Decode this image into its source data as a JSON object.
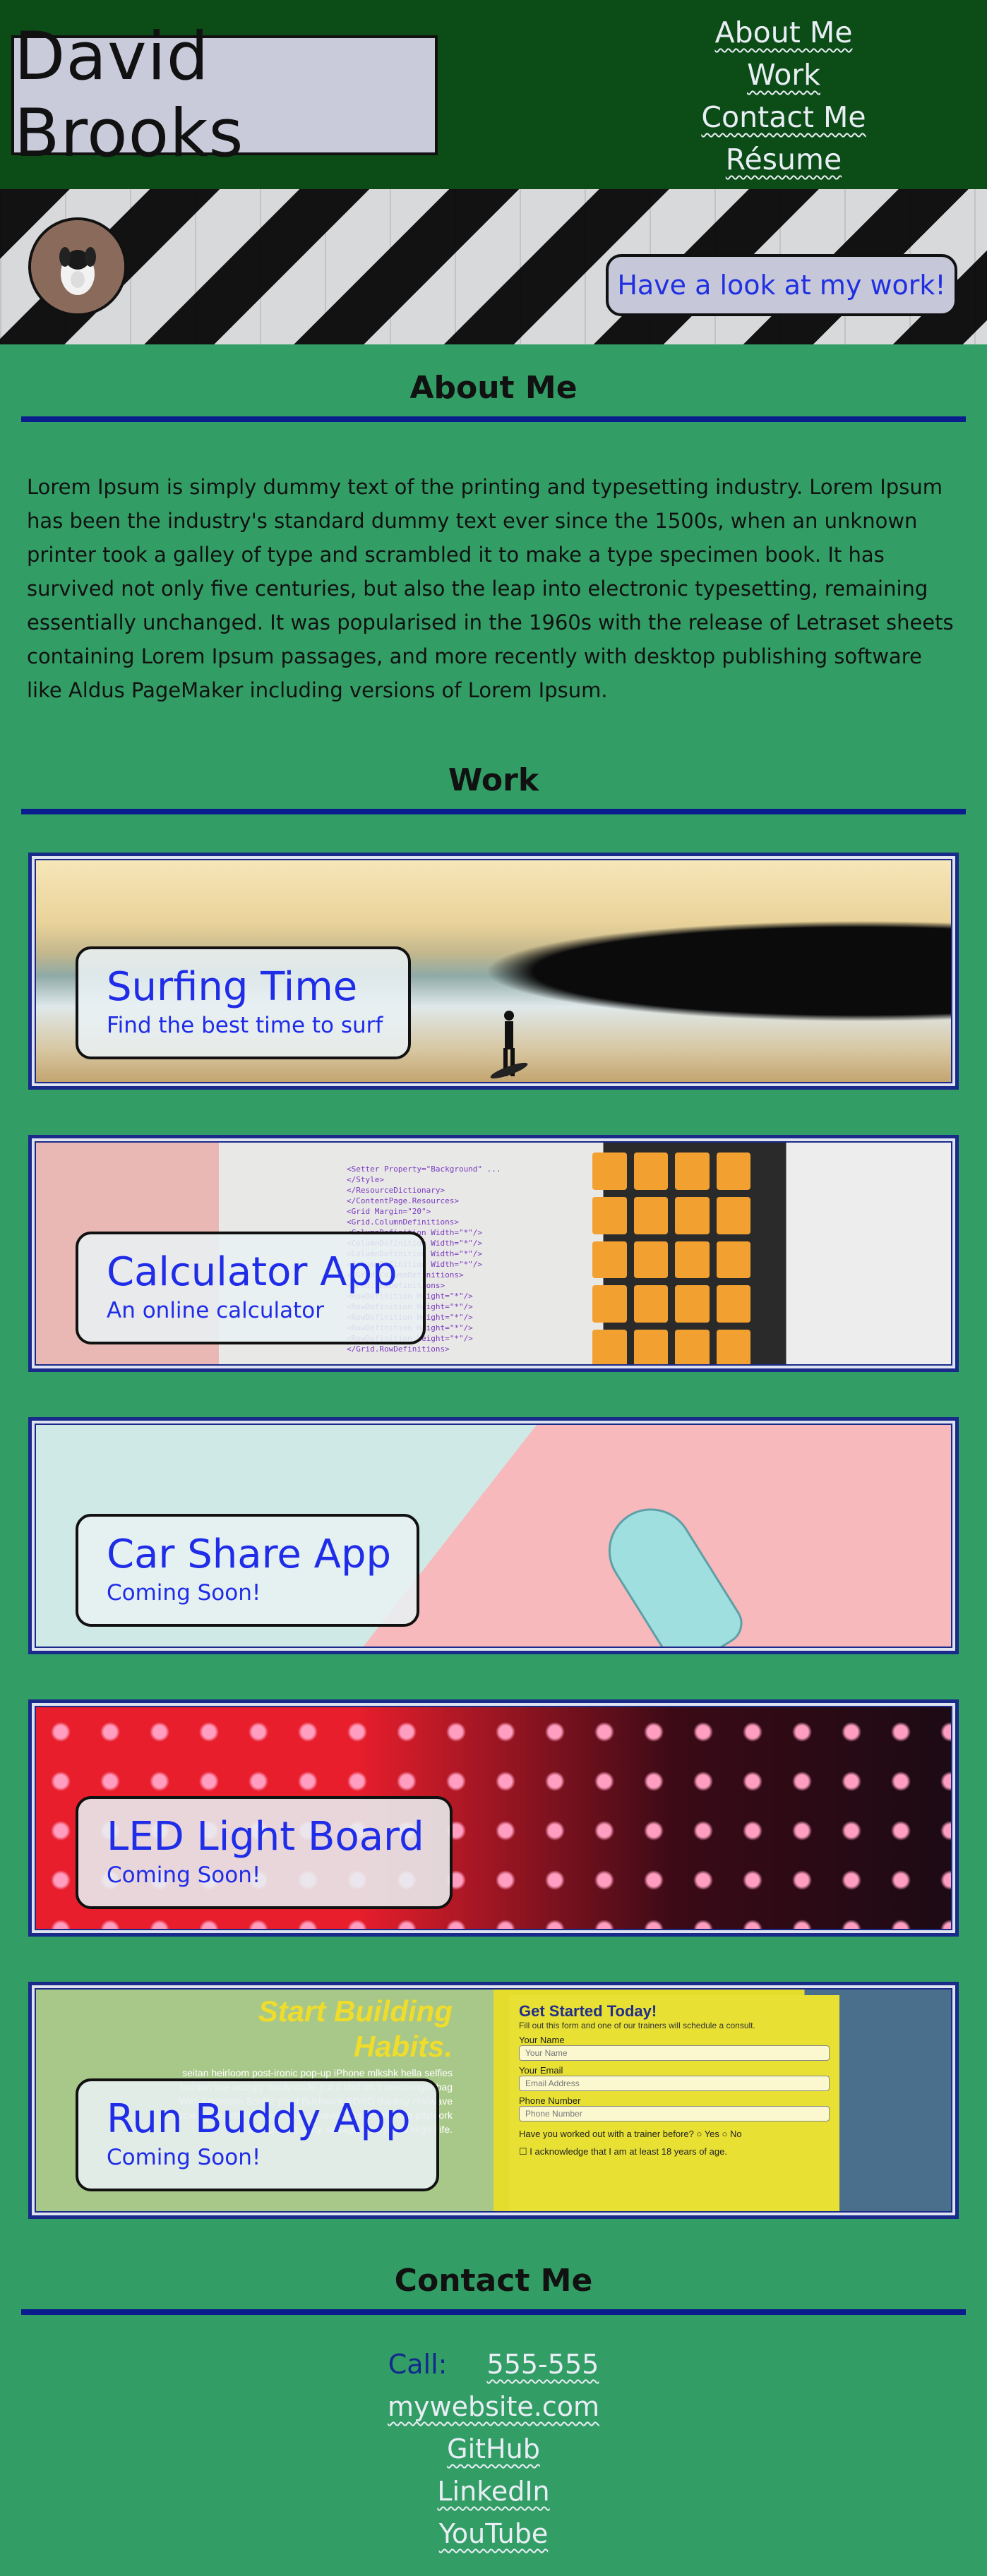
{
  "header": {
    "name": "David Brooks",
    "nav": [
      "About Me",
      "Work",
      "Contact Me",
      "Résume"
    ]
  },
  "hero": {
    "cta_label": "Have a look at my work!"
  },
  "about": {
    "title": "About Me",
    "text": "Lorem Ipsum is simply dummy text of the printing and typesetting industry. Lorem Ipsum has been the industry's standard dummy text ever since the 1500s, when an unknown printer took a galley of type and scrambled it to make a type specimen book. It has survived not only five centuries, but also the leap into electronic typesetting, remaining essentially unchanged. It was popularised in the 1960s with the release of Letraset sheets containing Lorem Ipsum passages, and more recently with desktop publishing software like Aldus PageMaker including versions of Lorem Ipsum."
  },
  "work": {
    "title": "Work",
    "projects": [
      {
        "title": "Surfing Time",
        "subtitle": "Find the best time to surf"
      },
      {
        "title": "Calculator App",
        "subtitle": "An online calculator"
      },
      {
        "title": "Car Share App",
        "subtitle": "Coming Soon!"
      },
      {
        "title": "LED Light Board",
        "subtitle": "Coming Soon!"
      },
      {
        "title": "Run Buddy App",
        "subtitle": "Coming Soon!"
      }
    ],
    "calc_code": [
      "<Setter Property=\"Background\" ...",
      "</Style>",
      "</ResourceDictionary>",
      "</ContentPage.Resources>",
      "<Grid Margin=\"20\">",
      "<Grid.ColumnDefinitions>",
      "<ColumnDefinition Width=\"*\"/>",
      "<ColumnDefinition Width=\"*\"/>",
      "<ColumnDefinition Width=\"*\"/>",
      "<ColumnDefinition Width=\"*\"/>",
      "</Grid.ColumnDefinitions>",
      "<Grid.RowDefinitions>",
      "<RowDefinition Height=\"*\"/>",
      "<RowDefinition Height=\"*\"/>",
      "<RowDefinition Height=\"*\"/>",
      "<RowDefinition Height=\"*\"/>",
      "<RowDefinition Height=\"*\"/>",
      "</Grid.RowDefinitions>"
    ],
    "run_buddy": {
      "headline_1": "Start Building",
      "headline_2": "Habits.",
      "filler": "seitan heirloom post-ironic pop-up iPhone mlkshk hella selfies fashion axe occupy readymade put a bird on it messenger bag Wes Anderson Schlitz plaid Bushwick XOXO Banksy chillwave bicycle rights retro cliche probably haven't heard of them pitchfork sriracha art party selvage letterpress High Life.",
      "form_title": "Get Started Today!",
      "form_subtitle": "Fill out this form and one of our trainers will schedule a consult.",
      "label_name": "Your Name",
      "placeholder_name": "Your Name",
      "label_email": "Your Email",
      "placeholder_email": "Email Address",
      "label_phone": "Phone Number",
      "placeholder_phone": "Phone Number",
      "question": "Have you worked out with a trainer before?",
      "yes": "Yes",
      "no": "No",
      "acknowledge": "I acknowledge that I am at least 18 years of age."
    }
  },
  "contact": {
    "title": "Contact Me",
    "call_label": "Call:",
    "phone": "555-555",
    "links": [
      "mywebsite.com",
      "GitHub",
      "LinkedIn",
      "YouTube"
    ]
  },
  "colors": {
    "page_bg": "#329e66",
    "header_bg": "#0c4d17",
    "rule": "#0a1d8c",
    "accent_text": "#1f2ce8"
  }
}
